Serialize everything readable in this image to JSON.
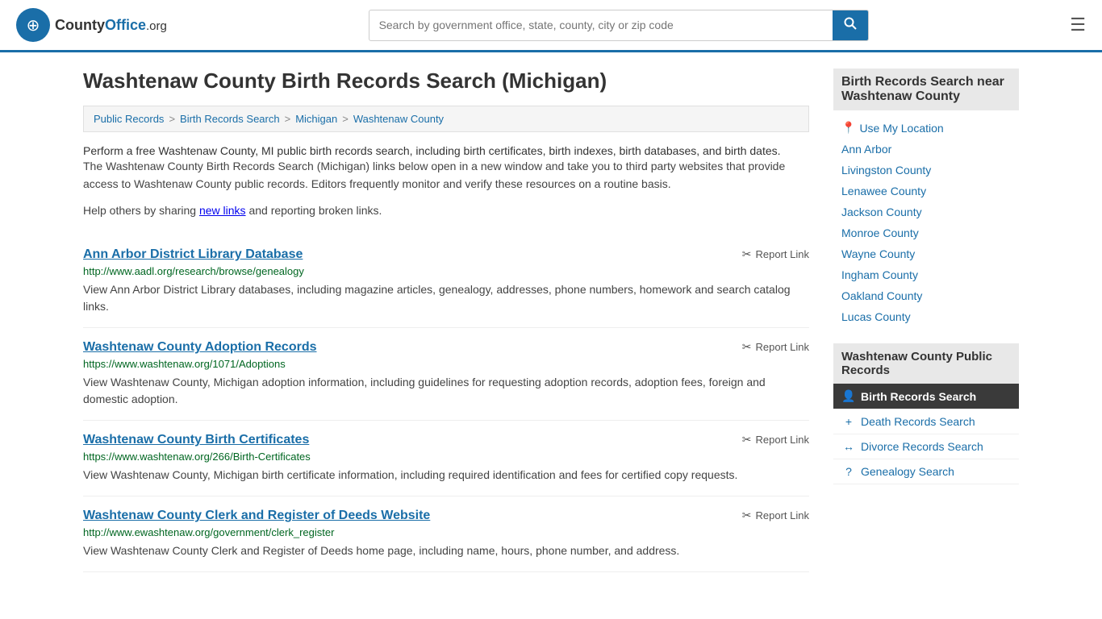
{
  "header": {
    "logo_text": "CountyOffice",
    "logo_tld": ".org",
    "search_placeholder": "Search by government office, state, county, city or zip code",
    "search_value": ""
  },
  "page": {
    "title": "Washtenaw County Birth Records Search (Michigan)"
  },
  "breadcrumb": {
    "items": [
      {
        "label": "Public Records",
        "href": "#"
      },
      {
        "label": "Birth Records Search",
        "href": "#"
      },
      {
        "label": "Michigan",
        "href": "#"
      },
      {
        "label": "Washtenaw County",
        "href": "#"
      }
    ]
  },
  "intro": {
    "text1": "Perform a free Washtenaw County, MI public birth records search, including birth certificates, birth indexes, birth databases, and birth dates.",
    "text2": "The Washtenaw County Birth Records Search (Michigan) links below open in a new window and take you to third party websites that provide access to Washtenaw County public records. Editors frequently monitor and verify these resources on a routine basis.",
    "text3_prefix": "Help others by sharing ",
    "text3_link": "new links",
    "text3_suffix": " and reporting broken links."
  },
  "results": [
    {
      "title": "Ann Arbor District Library Database",
      "url": "http://www.aadl.org/research/browse/genealogy",
      "desc": "View Ann Arbor District Library databases, including magazine articles, genealogy, addresses, phone numbers, homework and search catalog links.",
      "report_label": "Report Link"
    },
    {
      "title": "Washtenaw County Adoption Records",
      "url": "https://www.washtenaw.org/1071/Adoptions",
      "desc": "View Washtenaw County, Michigan adoption information, including guidelines for requesting adoption records, adoption fees, foreign and domestic adoption.",
      "report_label": "Report Link"
    },
    {
      "title": "Washtenaw County Birth Certificates",
      "url": "https://www.washtenaw.org/266/Birth-Certificates",
      "desc": "View Washtenaw County, Michigan birth certificate information, including required identification and fees for certified copy requests.",
      "report_label": "Report Link"
    },
    {
      "title": "Washtenaw County Clerk and Register of Deeds Website",
      "url": "http://www.ewashtenaw.org/government/clerk_register",
      "desc": "View Washtenaw County Clerk and Register of Deeds home page, including name, hours, phone number, and address.",
      "report_label": "Report Link"
    }
  ],
  "sidebar": {
    "nearby_heading": "Birth Records Search near Washtenaw County",
    "use_location": "Use My Location",
    "nearby_links": [
      "Ann Arbor",
      "Livingston County",
      "Lenawee County",
      "Jackson County",
      "Monroe County",
      "Wayne County",
      "Ingham County",
      "Oakland County",
      "Lucas County"
    ],
    "public_records_heading": "Washtenaw County Public Records",
    "public_records_items": [
      {
        "label": "Birth Records Search",
        "icon": "👤",
        "active": true
      },
      {
        "label": "Death Records Search",
        "icon": "+",
        "active": false
      },
      {
        "label": "Divorce Records Search",
        "icon": "↔",
        "active": false
      },
      {
        "label": "Genealogy Search",
        "icon": "?",
        "active": false
      }
    ]
  }
}
